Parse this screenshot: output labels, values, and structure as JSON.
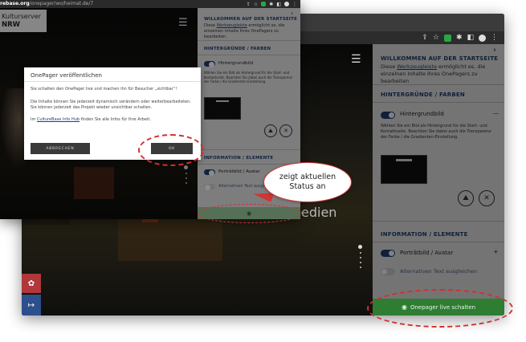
{
  "back_window": {
    "sidebar": {
      "welcome_title": "WILLKOMMEN AUF DER STARTSEITE",
      "welcome_text_prefix": "Diese ",
      "welcome_link": "Werkzeugleiste",
      "welcome_text_suffix": " ermöglicht es, die einzelnen Inhalte Ihres OnePagers zu bearbeiten",
      "section_backgrounds": "HINTERGRÜNDE / FARBEN",
      "background_toggle_label": "Hintergrundbild",
      "background_help": "Wählen Sie ein Bild als Hintergrund für die Start- und Kontaktseite. Beachten Sie dabei auch die Transparenz der Farbe / die Gradienten-Einstellung.",
      "section_info": "INFORMATION / ELEMENTE",
      "portrait_toggle_label": "Porträtbild / Avatar",
      "alt_text_toggle_label": "Alternativen Text ausgleichen",
      "live_button_label": "Onepager live schalten",
      "plus": "+",
      "minus": "—"
    },
    "overlay_text": "edien"
  },
  "front_window": {
    "url_prefix": "rebase.org",
    "url_path": "/onepager/wo/heimat.de/7",
    "logo_line1": "Kulturserver",
    "logo_line2": "NRW",
    "sidebar": {
      "welcome_title": "WILLKOMMEN AUF DER STARTSEITE",
      "welcome_text_prefix": "Diese ",
      "welcome_link": "Werkzeugleiste",
      "welcome_text_suffix": " ermöglicht es, die einzelnen Inhalte Ihres OnePagers zu bearbeiten.",
      "section_backgrounds": "HINTERGRÜNDE / FARBEN",
      "background_toggle_label": "Hintergrundbild",
      "background_help": "Wählen Sie ein Bild als Hintergrund für die Start- und Kontaktseite. Beachten Sie dabei auch die Transparenz der Farbe / die Gradienten-Einstellung.",
      "section_info": "INFORMATION / ELEMENTE",
      "portrait_toggle_label": "Porträtbild / Avatar",
      "alt_text_toggle_label": "Alternativen Text ausgl..."
    },
    "dialog": {
      "title": "OnePager veröffentlichen",
      "p1": "Sie schalten den OnePager live und machen ihn für Besucher „sichtbar“!",
      "p2": "Die Inhalte können Sie jederzeit dynamisch verändern oder weiterbearbeiteten. Sie können jederzeit das Projekt wieder unsichtbar schalten.",
      "p3_prefix": "Im ",
      "p3_link": "CultureBase Info Hub",
      "p3_suffix": " finden Sie alle Infos für Ihre Arbeit.",
      "cancel_label": "ABBRECHEN",
      "ok_label": "OK"
    }
  },
  "annotation": {
    "line1": "zeigt aktuellen",
    "line2": "Status an"
  },
  "colors": {
    "accent_blue": "#1f3f74",
    "live_green": "#2e7d32",
    "annotation_red": "#d32f2f",
    "left_bar_red": "#b0373a",
    "left_bar_blue": "#2d4f8e"
  }
}
